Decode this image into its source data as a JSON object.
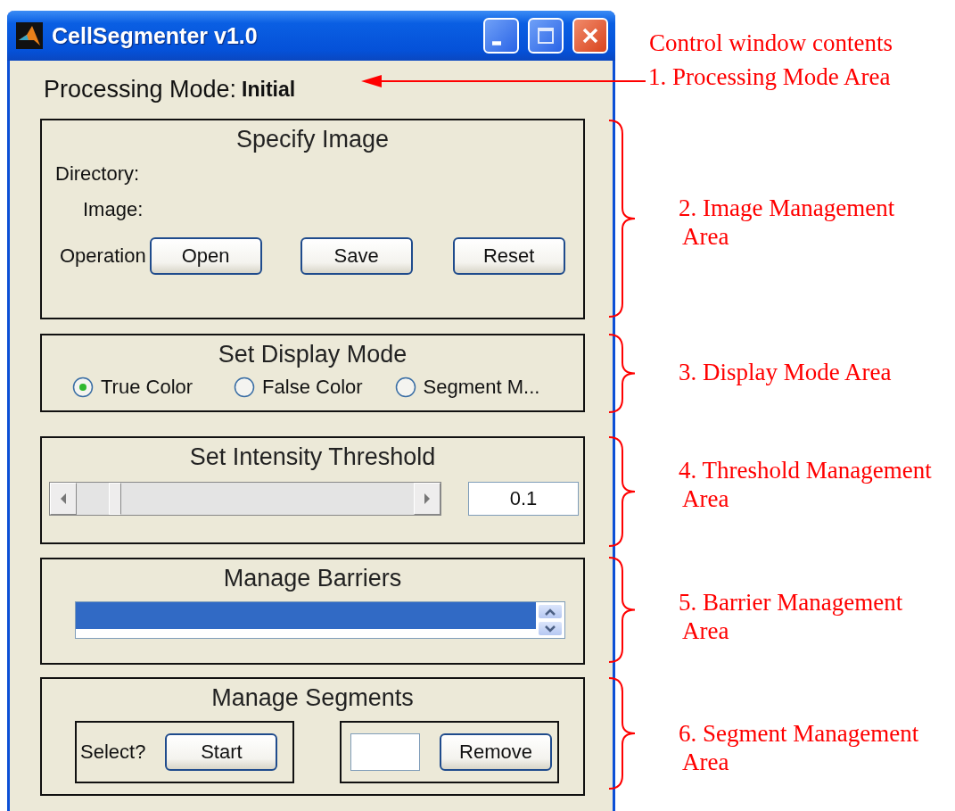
{
  "window": {
    "title": "CellSegmenter v1.0"
  },
  "processing_mode": {
    "label": "Processing Mode:",
    "value": "Initial"
  },
  "image_panel": {
    "title": "Specify Image",
    "directory_label": "Directory:",
    "image_label": "Image:",
    "operation_label": "Operation",
    "buttons": [
      "Open",
      "Save",
      "Reset"
    ]
  },
  "display_panel": {
    "title": "Set Display Mode",
    "options": [
      {
        "label": "True Color",
        "selected": true
      },
      {
        "label": "False Color",
        "selected": false
      },
      {
        "label": "Segment M...",
        "selected": false
      }
    ]
  },
  "threshold_panel": {
    "title": "Set Intensity Threshold",
    "slider": {
      "level": 0.1
    },
    "value": "0.1"
  },
  "barrier_panel": {
    "title": "Manage Barriers",
    "list_items": [
      {
        "selected": true
      }
    ]
  },
  "segment_panel": {
    "title": "Manage Segments",
    "select_label": "Select?",
    "start_button": "Start",
    "remove_button": "Remove"
  },
  "annotations": {
    "heading": "Control window contents",
    "items": [
      {
        "lines": [
          "1. Processing Mode Area"
        ]
      },
      {
        "lines": [
          "2. Image Management",
          "Area"
        ]
      },
      {
        "lines": [
          "3. Display Mode Area"
        ]
      },
      {
        "lines": [
          "4. Threshold Management",
          "Area"
        ]
      },
      {
        "lines": [
          "5. Barrier Management",
          "Area"
        ]
      },
      {
        "lines": [
          "6. Segment Management",
          "Area"
        ]
      }
    ]
  }
}
